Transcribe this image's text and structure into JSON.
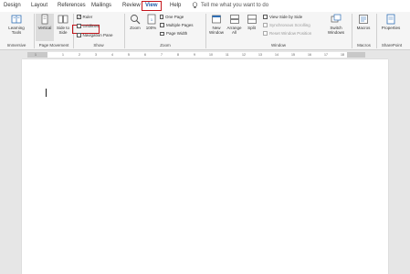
{
  "tabs": [
    {
      "label": "Design"
    },
    {
      "label": "Layout"
    },
    {
      "label": "References"
    },
    {
      "label": "Mailings"
    },
    {
      "label": "Review"
    },
    {
      "label": "View"
    },
    {
      "label": "Help"
    }
  ],
  "tell_me": "Tell me what you want to do",
  "ribbon": {
    "immersive": {
      "btn": "Learning Tools",
      "group": "Immersive"
    },
    "page_movement": {
      "vertical": "Vertical",
      "side": "Side to Side",
      "group": "Page Movement"
    },
    "show": {
      "ruler": "Ruler",
      "gridlines": "Gridlines",
      "nav_pane": "Navigation Pane",
      "group": "Show",
      "ruler_checked": true
    },
    "zoom": {
      "zoom": "Zoom",
      "pct": "100%",
      "one_page": "One Page",
      "multiple": "Multiple Pages",
      "page_width": "Page Width",
      "group": "Zoom"
    },
    "window": {
      "new": "New Window",
      "arrange": "Arrange All",
      "split": "Split",
      "side_by_side": "View Side by Side",
      "sync": "Synchronous Scrolling",
      "reset": "Reset Window Position",
      "switch": "Switch Windows",
      "group": "Window"
    },
    "macros": {
      "btn": "Macros",
      "group": "Macros"
    },
    "sharepoint": {
      "btn": "Properties",
      "group": "SharePoint"
    }
  },
  "ruler_ticks": [
    "1",
    "1",
    "2",
    "3",
    "4",
    "5",
    "6",
    "7",
    "8",
    "9",
    "10",
    "11",
    "12",
    "13",
    "14",
    "15",
    "16",
    "17",
    "18"
  ],
  "colors": {
    "accent": "#c4161c",
    "active_tab": "#1e5aa8",
    "icon_blue": "#2f6fb5"
  }
}
